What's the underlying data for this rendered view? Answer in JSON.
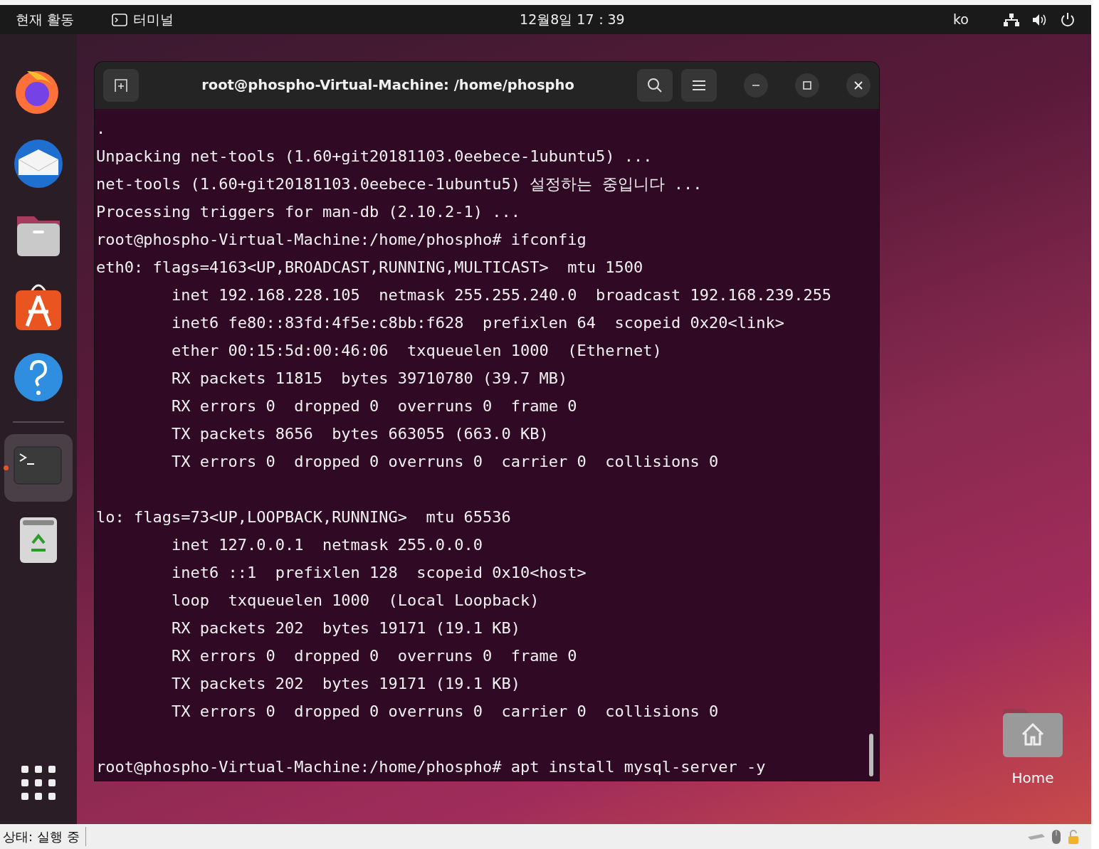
{
  "top_bar": {
    "activities": "현재 활동",
    "app_menu": "터미널",
    "clock": "12월8일 17：39",
    "input_method": "ko"
  },
  "dock": {
    "items": [
      {
        "kind": "firefox",
        "running": false
      },
      {
        "kind": "mail",
        "running": false
      },
      {
        "kind": "files",
        "running": false
      },
      {
        "kind": "software",
        "running": false
      },
      {
        "kind": "help",
        "running": false
      },
      {
        "kind": "separator",
        "running": false
      },
      {
        "kind": "terminal",
        "running": true
      },
      {
        "kind": "trash",
        "running": false
      }
    ]
  },
  "terminal": {
    "title": "root@phospho-Virtual-Machine: /home/phospho",
    "lines": [
      {
        "kind": "text",
        "text": "."
      },
      {
        "kind": "text",
        "text": "Unpacking net-tools (1.60+git20181103.0eebece-1ubuntu5) ..."
      },
      {
        "kind": "text",
        "text": "net-tools (1.60+git20181103.0eebece-1ubuntu5) 설정하는 중입니다 ..."
      },
      {
        "kind": "text",
        "text": "Processing triggers for man-db (2.10.2-1) ..."
      },
      {
        "kind": "text",
        "text": "root@phospho-Virtual-Machine:/home/phospho# ifconfig"
      },
      {
        "kind": "text",
        "text": "eth0: flags=4163<UP,BROADCAST,RUNNING,MULTICAST>  mtu 1500"
      },
      {
        "kind": "text",
        "text": "        inet 192.168.228.105  netmask 255.255.240.0  broadcast 192.168.239.255"
      },
      {
        "kind": "text",
        "text": "        inet6 fe80::83fd:4f5e:c8bb:f628  prefixlen 64  scopeid 0x20<link>"
      },
      {
        "kind": "text",
        "text": "        ether 00:15:5d:00:46:06  txqueuelen 1000  (Ethernet)"
      },
      {
        "kind": "text",
        "text": "        RX packets 11815  bytes 39710780 (39.7 MB)"
      },
      {
        "kind": "text",
        "text": "        RX errors 0  dropped 0  overruns 0  frame 0"
      },
      {
        "kind": "text",
        "text": "        TX packets 8656  bytes 663055 (663.0 KB)"
      },
      {
        "kind": "text",
        "text": "        TX errors 0  dropped 0 overruns 0  carrier 0  collisions 0"
      },
      {
        "kind": "blank"
      },
      {
        "kind": "text",
        "text": "lo: flags=73<UP,LOOPBACK,RUNNING>  mtu 65536"
      },
      {
        "kind": "text",
        "text": "        inet 127.0.0.1  netmask 255.0.0.0"
      },
      {
        "kind": "text",
        "text": "        inet6 ::1  prefixlen 128  scopeid 0x10<host>"
      },
      {
        "kind": "text",
        "text": "        loop  txqueuelen 1000  (Local Loopback)"
      },
      {
        "kind": "text",
        "text": "        RX packets 202  bytes 19171 (19.1 KB)"
      },
      {
        "kind": "text",
        "text": "        RX errors 0  dropped 0  overruns 0  frame 0"
      },
      {
        "kind": "text",
        "text": "        TX packets 202  bytes 19171 (19.1 KB)"
      },
      {
        "kind": "text",
        "text": "        TX errors 0  dropped 0 overruns 0  carrier 0  collisions 0"
      },
      {
        "kind": "blank"
      },
      {
        "kind": "text",
        "text": "root@phospho-Virtual-Machine:/home/phospho# apt install mysql-server -y"
      }
    ]
  },
  "desktop_icons": [
    {
      "label": "Home"
    }
  ],
  "status_bar": {
    "text": "상태: 실행 중"
  }
}
